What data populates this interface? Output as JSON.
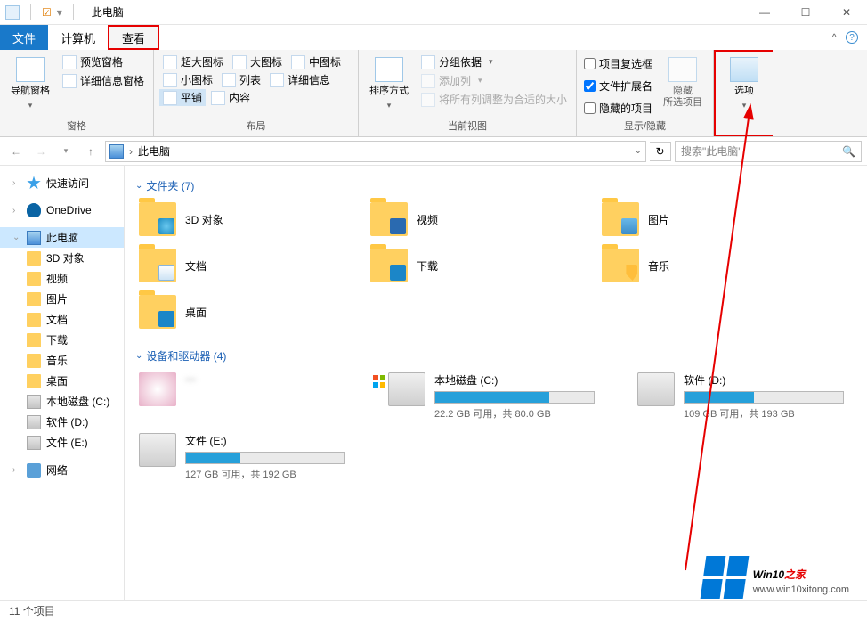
{
  "titlebar": {
    "title": "此电脑"
  },
  "win_controls": {
    "min": "—",
    "max": "☐",
    "close": "✕"
  },
  "tabs": {
    "file": "文件",
    "computer": "计算机",
    "view": "查看",
    "collapse": "^",
    "help": "?"
  },
  "ribbon": {
    "panes": {
      "nav": {
        "btn": "导航窗格",
        "preview": "预览窗格",
        "details": "详细信息窗格",
        "group": "窗格"
      },
      "layout": {
        "xlarge": "超大图标",
        "large": "大图标",
        "medium": "中图标",
        "small": "小图标",
        "list": "列表",
        "details": "详细信息",
        "tiles": "平铺",
        "content": "内容",
        "group": "布局"
      },
      "view": {
        "sort": "排序方式",
        "groupby": "分组依据",
        "addcol": "添加列",
        "sizeall": "将所有列调整为合适的大小",
        "group": "当前视图"
      },
      "showhide": {
        "checkboxes": "项目复选框",
        "ext": "文件扩展名",
        "hidden": "隐藏的项目",
        "hidebtn": "隐藏\n所选项目",
        "group": "显示/隐藏"
      },
      "options": {
        "btn": "选项"
      }
    }
  },
  "addr": {
    "location": "此电脑",
    "search_placeholder": "搜索\"此电脑\""
  },
  "sidebar": {
    "quick": "快速访问",
    "onedrive": "OneDrive",
    "thispc": "此电脑",
    "items": [
      {
        "label": "3D 对象"
      },
      {
        "label": "视频"
      },
      {
        "label": "图片"
      },
      {
        "label": "文档"
      },
      {
        "label": "下载"
      },
      {
        "label": "音乐"
      },
      {
        "label": "桌面"
      },
      {
        "label": "本地磁盘 (C:)"
      },
      {
        "label": "软件 (D:)"
      },
      {
        "label": "文件 (E:)"
      }
    ],
    "network": "网络"
  },
  "sections": {
    "folders": {
      "title": "文件夹 (7)",
      "items": [
        {
          "label": "3D 对象"
        },
        {
          "label": "视频"
        },
        {
          "label": "图片"
        },
        {
          "label": "文档"
        },
        {
          "label": "下载"
        },
        {
          "label": "音乐"
        },
        {
          "label": "桌面"
        }
      ]
    },
    "drives": {
      "title": "设备和驱动器 (4)",
      "items": [
        {
          "name": "—",
          "text": "",
          "fill": 0
        },
        {
          "name": "本地磁盘 (C:)",
          "text": "22.2 GB 可用，共 80.0 GB",
          "fill": 72
        },
        {
          "name": "软件 (D:)",
          "text": "109 GB 可用，共 193 GB",
          "fill": 44
        },
        {
          "name": "文件 (E:)",
          "text": "127 GB 可用，共 192 GB",
          "fill": 34
        }
      ]
    }
  },
  "status": {
    "text": "11 个项目"
  },
  "watermark": {
    "brand1": "Win10",
    "brand2": "之家",
    "url": "www.win10xitong.com"
  }
}
